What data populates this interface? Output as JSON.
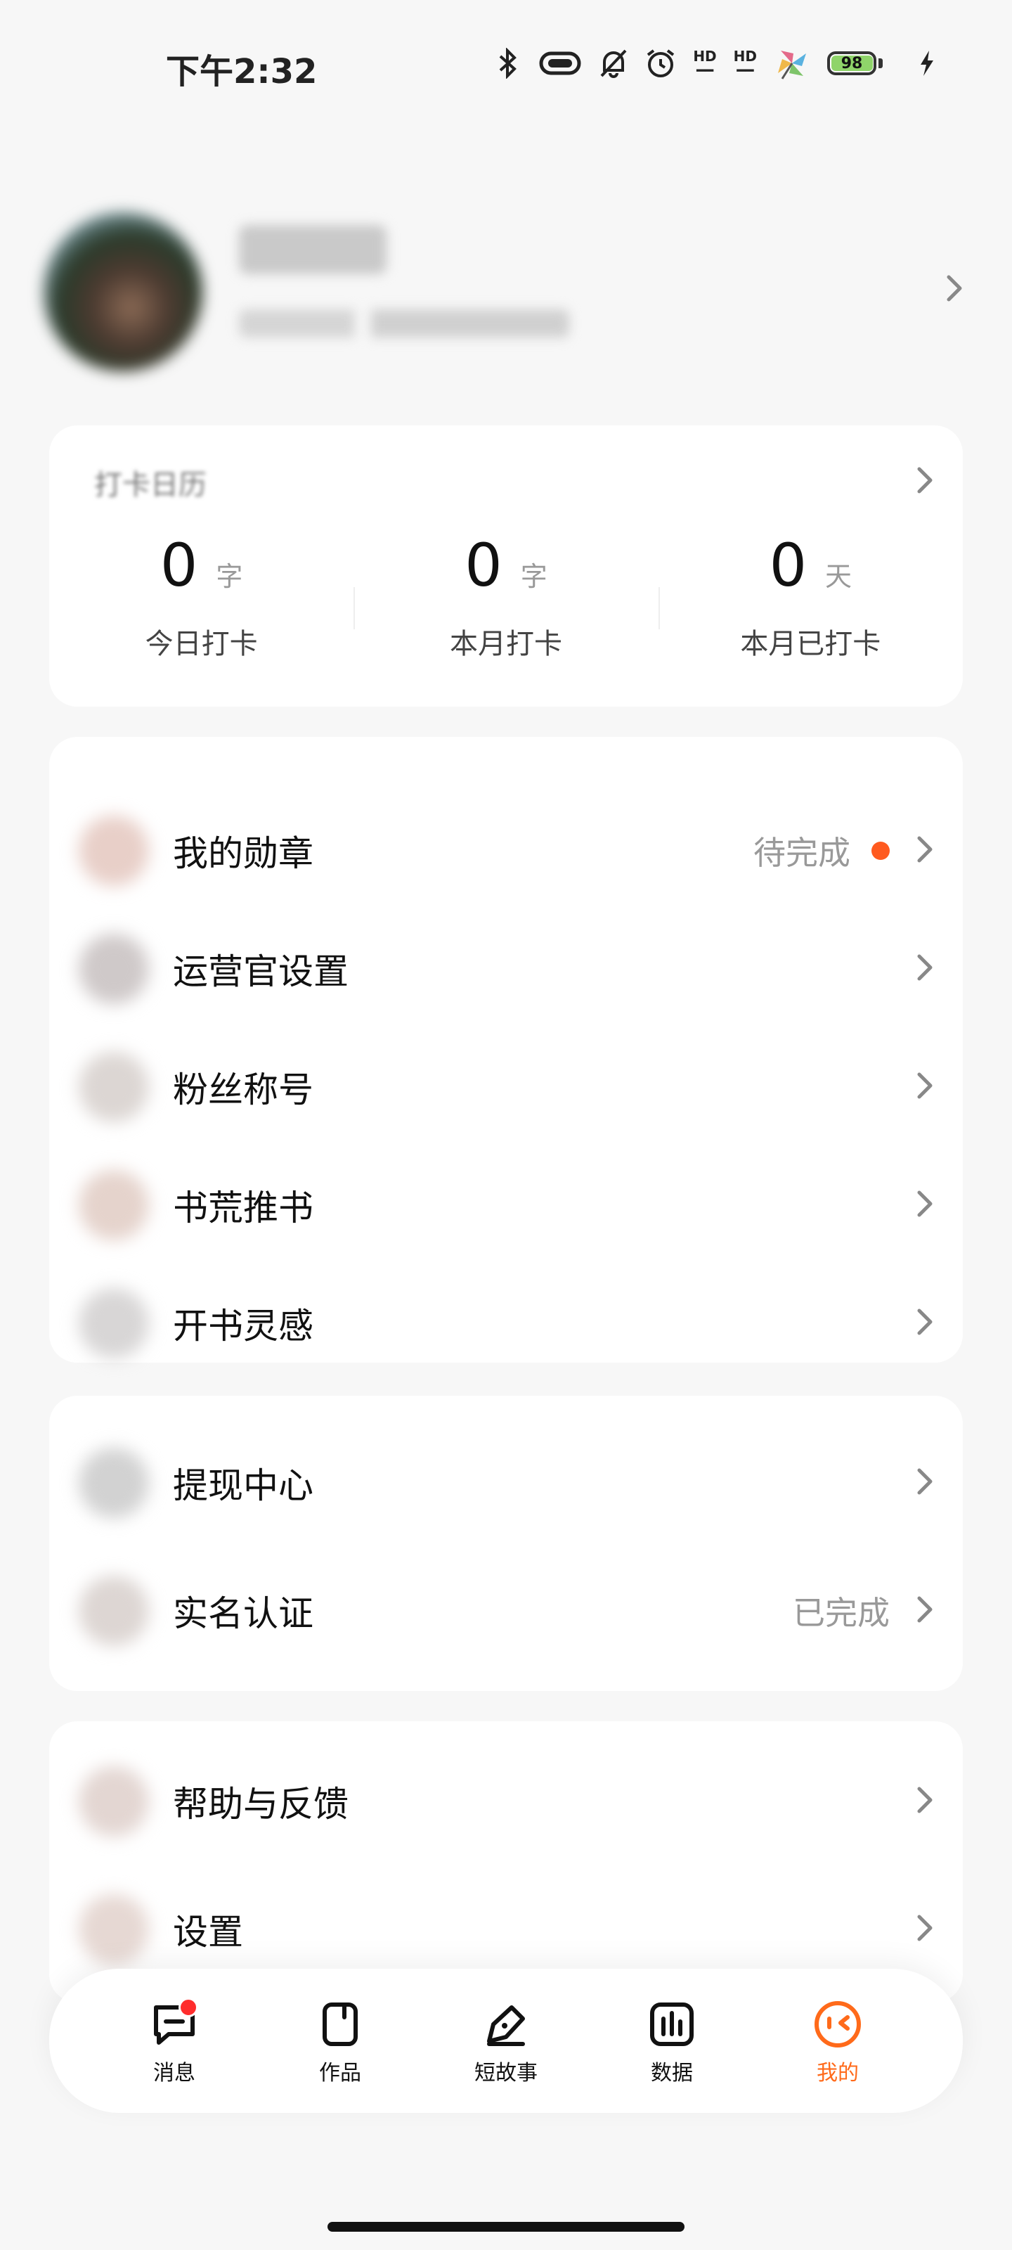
{
  "status_bar": {
    "time": "下午2:32",
    "battery": "98"
  },
  "checkin": {
    "title": "打卡日历",
    "stats": [
      {
        "value": "0",
        "unit": "字",
        "label": "今日打卡"
      },
      {
        "value": "0",
        "unit": "字",
        "label": "本月打卡"
      },
      {
        "value": "0",
        "unit": "天",
        "label": "本月已打卡"
      }
    ]
  },
  "menu_group1": [
    {
      "label": "我的勋章",
      "status": "待完成",
      "has_dot": true
    },
    {
      "label": "运营官设置"
    },
    {
      "label": "粉丝称号"
    },
    {
      "label": "书荒推书"
    },
    {
      "label": "开书灵感"
    }
  ],
  "menu_group2": [
    {
      "label": "提现中心"
    },
    {
      "label": "实名认证",
      "status": "已完成"
    }
  ],
  "menu_group3": [
    {
      "label": "帮助与反馈"
    },
    {
      "label": "设置"
    }
  ],
  "tabs": [
    {
      "label": "消息",
      "icon": "message-icon",
      "badge": true
    },
    {
      "label": "作品",
      "icon": "works-icon"
    },
    {
      "label": "短故事",
      "icon": "pen-icon"
    },
    {
      "label": "数据",
      "icon": "chart-icon"
    },
    {
      "label": "我的",
      "icon": "mine-icon",
      "active": true
    }
  ],
  "colors": {
    "accent": "#ff6a1a",
    "dot": "#ff5a1f",
    "badge": "#ff2d2d"
  }
}
